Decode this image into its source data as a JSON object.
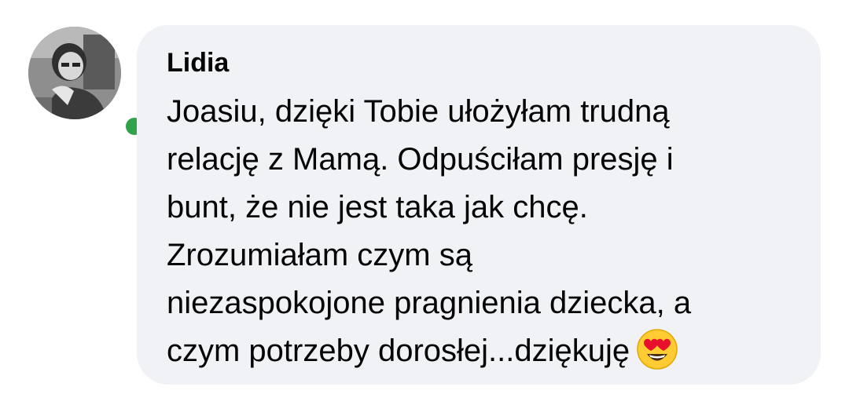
{
  "comment": {
    "author": "Lidia",
    "online": true,
    "avatar_icon": "user-photo-avatar",
    "status_color": "#31a24c",
    "text_lines": [
      "Joasiu, dzięki Tobie ułożyłam trudną",
      "relację z Mamą. Odpuściłam presję i",
      "bunt, że nie jest taka jak chcę.",
      "Zrozumiałam czym są",
      "niezaspokojone pragnienia dziecka, a",
      "czym potrzeby dorosłej...dziękuję"
    ],
    "trailing_emoji": "heart-eyes-emoji"
  }
}
